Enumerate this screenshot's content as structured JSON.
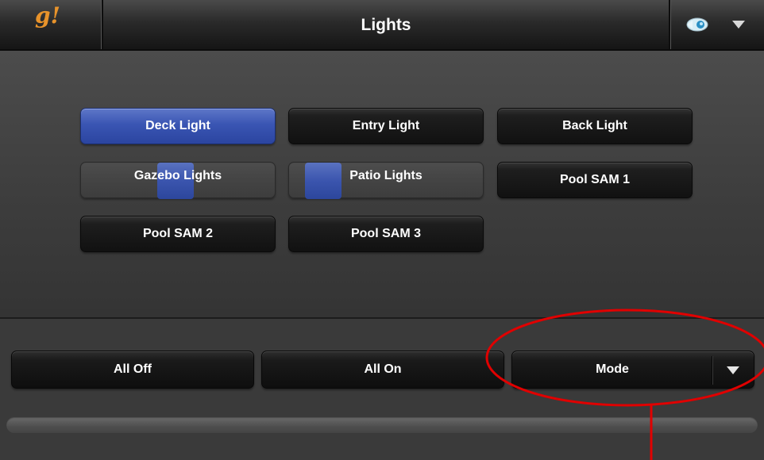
{
  "header": {
    "logo": "g!",
    "title": "Lights",
    "tool_icon": "remote-wand-icon",
    "menu_icon": "chevron-down-icon"
  },
  "lights": [
    {
      "label": "Deck Light",
      "state": "on",
      "level": 1.0
    },
    {
      "label": "Entry Light",
      "state": "off",
      "level": 0
    },
    {
      "label": "Back Light",
      "state": "off",
      "level": 0
    },
    {
      "label": "Gazebo Lights",
      "state": "dimmed",
      "level": 0.45
    },
    {
      "label": "Patio Lights",
      "state": "dimmed",
      "level": 0.12
    },
    {
      "label": "Pool SAM 1",
      "state": "off",
      "level": 0
    },
    {
      "label": "Pool SAM 2",
      "state": "off",
      "level": 0
    },
    {
      "label": "Pool SAM 3",
      "state": "off",
      "level": 0
    }
  ],
  "actions": {
    "all_off": "All Off",
    "all_on": "All On",
    "mode": "Mode"
  },
  "colors": {
    "on": "#3a55b3",
    "logo": "#e8932b",
    "annotation": "#e00000"
  }
}
